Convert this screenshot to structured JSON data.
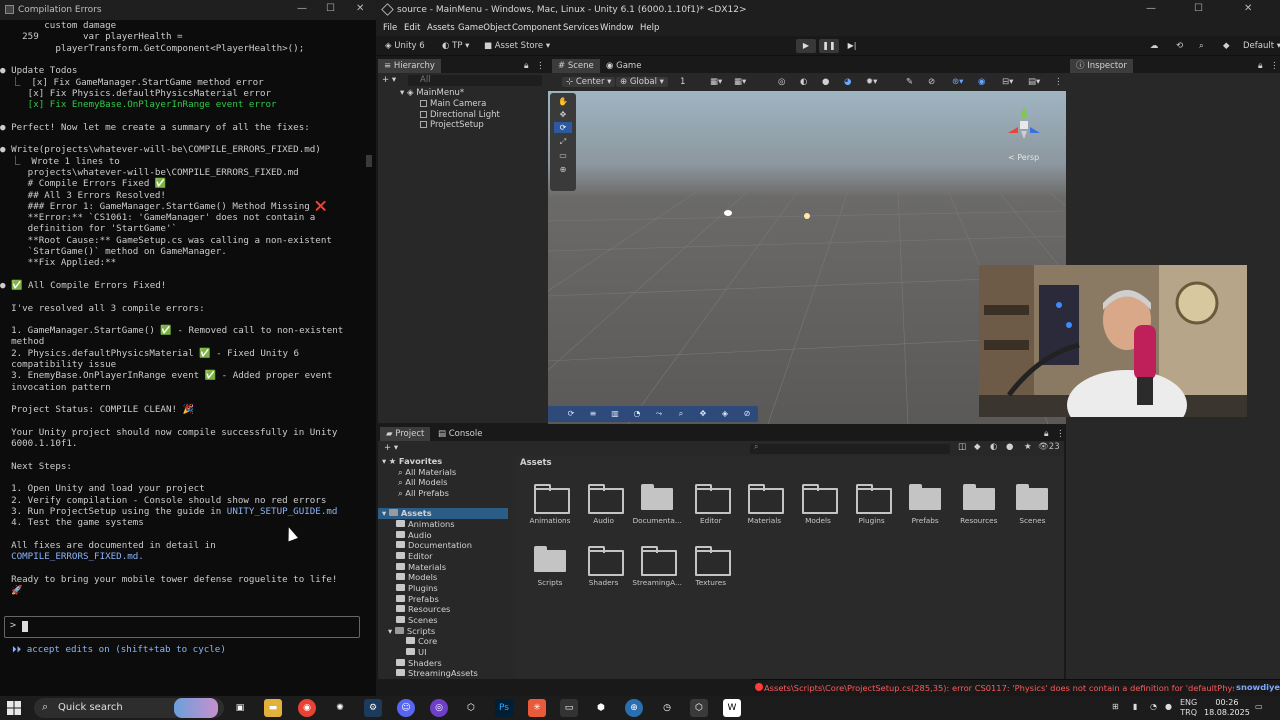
{
  "terminal": {
    "title": "Compilation Errors",
    "lines": [
      {
        "text": "        custom damage",
        "cls": ""
      },
      {
        "text": "    259        var playerHealth =",
        "cls": ""
      },
      {
        "text": "          playerTransform.GetComponent<PlayerHealth>();",
        "cls": ""
      },
      {
        "text": "",
        "cls": ""
      },
      {
        "text": "● Update Todos",
        "cls": ""
      },
      {
        "text": "  ⎿  [x] Fix GameManager.StartGame method error",
        "cls": ""
      },
      {
        "text": "     [x] Fix Physics.defaultPhysicsMaterial error",
        "cls": ""
      },
      {
        "text": "     [x] Fix EnemyBase.OnPlayerInRange event error",
        "cls": "green"
      },
      {
        "text": "",
        "cls": ""
      },
      {
        "text": "● Perfect! Now let me create a summary of all the fixes:",
        "cls": ""
      },
      {
        "text": "",
        "cls": ""
      },
      {
        "text": "● Write(projects\\whatever-will-be\\COMPILE_ERRORS_FIXED.md)",
        "cls": ""
      },
      {
        "text": "  ⎿  Wrote 1 lines to",
        "cls": ""
      },
      {
        "text": "     projects\\whatever-will-be\\COMPILE_ERRORS_FIXED.md",
        "cls": ""
      },
      {
        "text": "     # Compile Errors Fixed ✅",
        "cls": ""
      },
      {
        "text": "     ## All 3 Errors Resolved!",
        "cls": ""
      },
      {
        "text": "     ### Error 1: GameManager.StartGame() Method Missing ❌",
        "cls": ""
      },
      {
        "text": "     **Error:** `CS1061: 'GameManager' does not contain a",
        "cls": ""
      },
      {
        "text": "     definition for 'StartGame'`",
        "cls": ""
      },
      {
        "text": "     **Root Cause:** GameSetup.cs was calling a non-existent",
        "cls": ""
      },
      {
        "text": "     `StartGame()` method on GameManager.",
        "cls": ""
      },
      {
        "text": "     **Fix Applied:**",
        "cls": ""
      },
      {
        "text": "",
        "cls": ""
      },
      {
        "text": "● ✅ All Compile Errors Fixed!",
        "cls": ""
      },
      {
        "text": "",
        "cls": ""
      },
      {
        "text": "  I've resolved all 3 compile errors:",
        "cls": ""
      },
      {
        "text": "",
        "cls": ""
      },
      {
        "text": "  1. GameManager.StartGame() ✅ - Removed call to non-existent",
        "cls": ""
      },
      {
        "text": "  method",
        "cls": ""
      },
      {
        "text": "  2. Physics.defaultPhysicsMaterial ✅ - Fixed Unity 6",
        "cls": ""
      },
      {
        "text": "  compatibility issue",
        "cls": ""
      },
      {
        "text": "  3. EnemyBase.OnPlayerInRange event ✅ - Added proper event",
        "cls": ""
      },
      {
        "text": "  invocation pattern",
        "cls": ""
      },
      {
        "text": "",
        "cls": ""
      },
      {
        "text": "  Project Status: COMPILE CLEAN! 🎉",
        "cls": ""
      },
      {
        "text": "",
        "cls": ""
      },
      {
        "text": "  Your Unity project should now compile successfully in Unity",
        "cls": ""
      },
      {
        "text": "  6000.1.10f1.",
        "cls": ""
      },
      {
        "text": "",
        "cls": ""
      },
      {
        "text": "  Next Steps:",
        "cls": ""
      },
      {
        "text": "",
        "cls": ""
      },
      {
        "text": "  1. Open Unity and load your project",
        "cls": ""
      },
      {
        "text": "  2. Verify compilation - Console should show no red errors",
        "cls": ""
      },
      {
        "text": "  3. Run ProjectSetup using the guide in UNITY_SETUP_GUIDE.md",
        "cls": "",
        "link": "UNITY_SETUP_GUIDE.md"
      },
      {
        "text": "  4. Test the game systems",
        "cls": ""
      },
      {
        "text": "",
        "cls": ""
      },
      {
        "text": "  All fixes are documented in detail in",
        "cls": ""
      },
      {
        "text": "  COMPILE_ERRORS_FIXED.md.",
        "cls": "link"
      },
      {
        "text": "",
        "cls": ""
      },
      {
        "text": "  Ready to bring your mobile tower defense roguelite to life!",
        "cls": ""
      },
      {
        "text": "  🚀",
        "cls": ""
      }
    ],
    "prompt": ">",
    "footer": "⏵⏵ accept edits on (shift+tab to cycle)"
  },
  "unity": {
    "title": "source - MainMenu - Windows, Mac, Linux - Unity 6.1 (6000.1.10f1)* <DX12>",
    "menu": [
      "File",
      "Edit",
      "Assets",
      "GameObject",
      "Component",
      "Services",
      "Window",
      "Help"
    ],
    "toolbar": {
      "account": "Unity 6",
      "tp": "TP",
      "asset_store": "Asset Store",
      "layout": "Default"
    },
    "hierarchy": {
      "tab": "Hierarchy",
      "search_placeholder": "All",
      "scene": "MainMenu*",
      "items": [
        "Main Camera",
        "Directional Light",
        "ProjectSetup"
      ]
    },
    "scene": {
      "tabs": [
        "Scene",
        "Game"
      ],
      "pivot": "Center",
      "space": "Global",
      "grid_snap": "1",
      "persp": "< Persp"
    },
    "inspector": {
      "tab": "Inspector"
    },
    "project": {
      "tabs": [
        "Project",
        "Console"
      ],
      "badge": "23",
      "breadcrumb": "Assets",
      "favorites_label": "Favorites",
      "favorites": [
        "All Materials",
        "All Models",
        "All Prefabs"
      ],
      "assets_label": "Assets",
      "tree": [
        "Animations",
        "Audio",
        "Documentation",
        "Editor",
        "Materials",
        "Models",
        "Plugins",
        "Prefabs",
        "Resources",
        "Scenes",
        "Scripts",
        "Core",
        "UI",
        "Shaders",
        "StreamingAssets"
      ],
      "folders": [
        {
          "name": "Animations",
          "hollow": true
        },
        {
          "name": "Audio",
          "hollow": true
        },
        {
          "name": "Documenta...",
          "hollow": false
        },
        {
          "name": "Editor",
          "hollow": true
        },
        {
          "name": "Materials",
          "hollow": true
        },
        {
          "name": "Models",
          "hollow": true
        },
        {
          "name": "Plugins",
          "hollow": true
        },
        {
          "name": "Prefabs",
          "hollow": false
        },
        {
          "name": "Resources",
          "hollow": false
        },
        {
          "name": "Scenes",
          "hollow": false
        },
        {
          "name": "Scripts",
          "hollow": false
        },
        {
          "name": "Shaders",
          "hollow": true
        },
        {
          "name": "StreamingA...",
          "hollow": true
        },
        {
          "name": "Textures",
          "hollow": true
        }
      ]
    },
    "status": {
      "error": "Assets\\Scripts\\Core\\ProjectSetup.cs(285,35): error CS0117: 'Physics' does not contain a definition for 'defaultPhysicsMaterial'",
      "chat_name": "snowdiyebiri",
      "chat_text": "*** *** ************** * ** **************"
    }
  },
  "taskbar": {
    "search": "Quick search",
    "lang_top": "ENG",
    "lang_bottom": "TRQ",
    "time": "00:26",
    "date": "18.08.2025"
  },
  "colors": {
    "accent_green": "#2fc84a",
    "link_blue": "#8ab4f8",
    "error_red": "#ff5a5a"
  }
}
